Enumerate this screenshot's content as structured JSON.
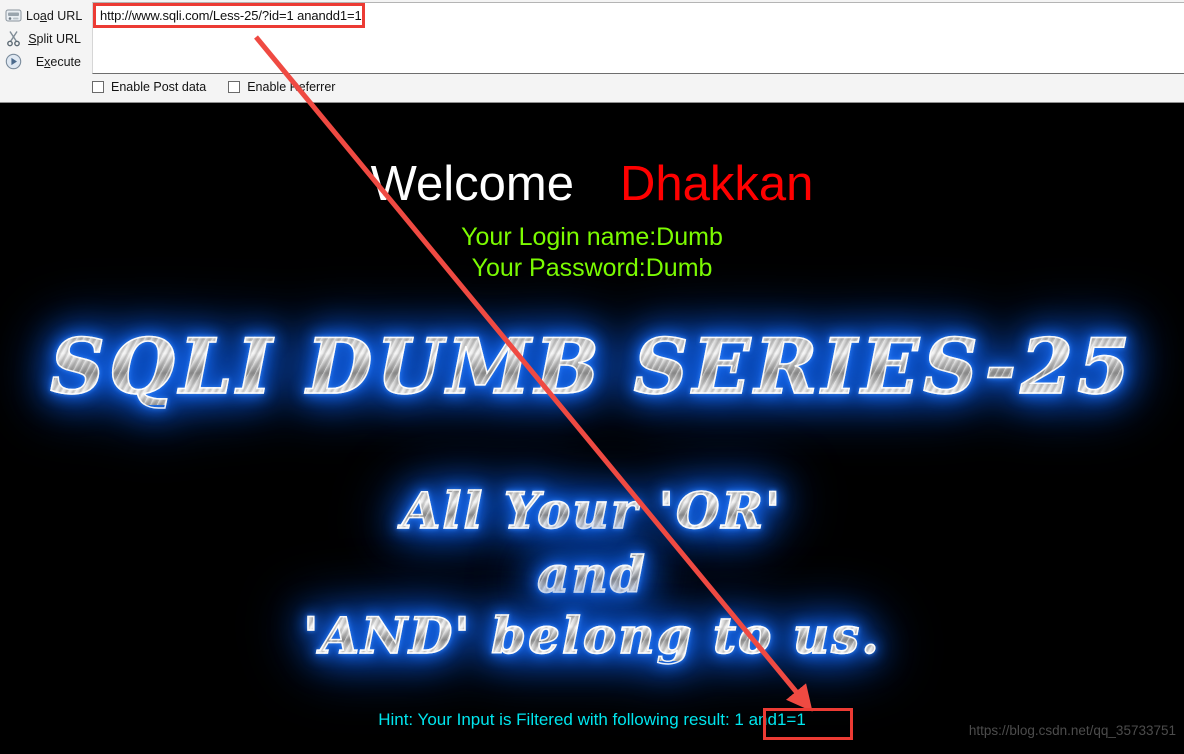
{
  "toolbar": {
    "actions": [
      {
        "label_pre": "Lo",
        "label_accel": "a",
        "label_post": "d URL",
        "icon": "disk-icon",
        "full": "Load URL"
      },
      {
        "label_pre": "",
        "label_accel": "S",
        "label_post": "plit URL",
        "icon": "scissors-icon",
        "full": "Split URL"
      },
      {
        "label_pre": "E",
        "label_accel": "x",
        "label_post": "ecute",
        "icon": "execute-play-icon",
        "full": "Execute"
      }
    ],
    "url_value": "http://www.sqli.com/Less-25/?id=1 anandd1=1",
    "checkboxes": [
      {
        "label": "Enable Post data",
        "checked": false
      },
      {
        "label": "Enable Referrer",
        "checked": false
      }
    ]
  },
  "page": {
    "welcome": "Welcome",
    "username_display": "Dhakkan",
    "login_name": "Your Login name:Dumb",
    "password": "Your Password:Dumb",
    "title": "SQLI DUMB SERIES-25",
    "subtitle_line1": "All Your 'OR'",
    "subtitle_line2": "and",
    "subtitle_line3": "'AND' belong to us.",
    "hint_prefix": "Hint: Your Input is Filtered with following result: ",
    "hint_result": "1 and1=1",
    "watermark": "https://blog.csdn.net/qq_35733751"
  },
  "colors": {
    "welcome": "#ffffff",
    "username": "#ff0000",
    "credentials": "#7cfc00",
    "hint": "#00e5ee",
    "annotation_red": "#ec3b34",
    "title_glow": "#1a6cf0",
    "page_background": "#000000",
    "toolbar_background": "#f4f4f4"
  }
}
